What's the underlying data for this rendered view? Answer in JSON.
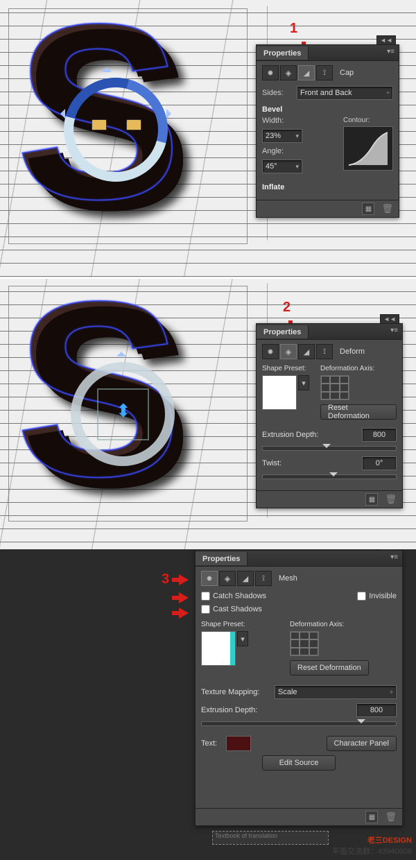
{
  "section1": {
    "number": "1",
    "panel_title": "Properties",
    "mode_label": "Cap",
    "sides_label": "Sides:",
    "sides_value": "Front and Back",
    "bevel_label": "Bevel",
    "width_label": "Width:",
    "width_value": "23%",
    "angle_label": "Angle:",
    "angle_value": "45°",
    "contour_label": "Contour:",
    "inflate_label": "Inflate"
  },
  "section2": {
    "number": "2",
    "panel_title": "Properties",
    "mode_label": "Deform",
    "shape_preset_label": "Shape Preset:",
    "deform_axis_label": "Deformation Axis:",
    "reset_deform": "Reset Deformation",
    "extrusion_label": "Extrusion Depth:",
    "extrusion_value": "800",
    "twist_label": "Twist:",
    "twist_value": "0°"
  },
  "section3": {
    "number": "3",
    "panel_title": "Properties",
    "mode_label": "Mesh",
    "catch_shadows": "Catch Shadows",
    "invisible": "Invisible",
    "cast_shadows": "Cast Shadows",
    "shape_preset_label": "Shape Preset:",
    "deform_axis_label": "Deformation Axis:",
    "reset_deform": "Reset Deformation",
    "texture_mapping_label": "Texture Mapping:",
    "texture_mapping_value": "Scale",
    "extrusion_label": "Extrusion Depth:",
    "extrusion_value": "800",
    "text_label": "Text:",
    "character_panel": "Character Panel",
    "edit_source": "Edit Source",
    "strip": "Textbook of translation",
    "watermark_brand": "DESIGN",
    "watermark_group": "平面交流群：43940608"
  }
}
